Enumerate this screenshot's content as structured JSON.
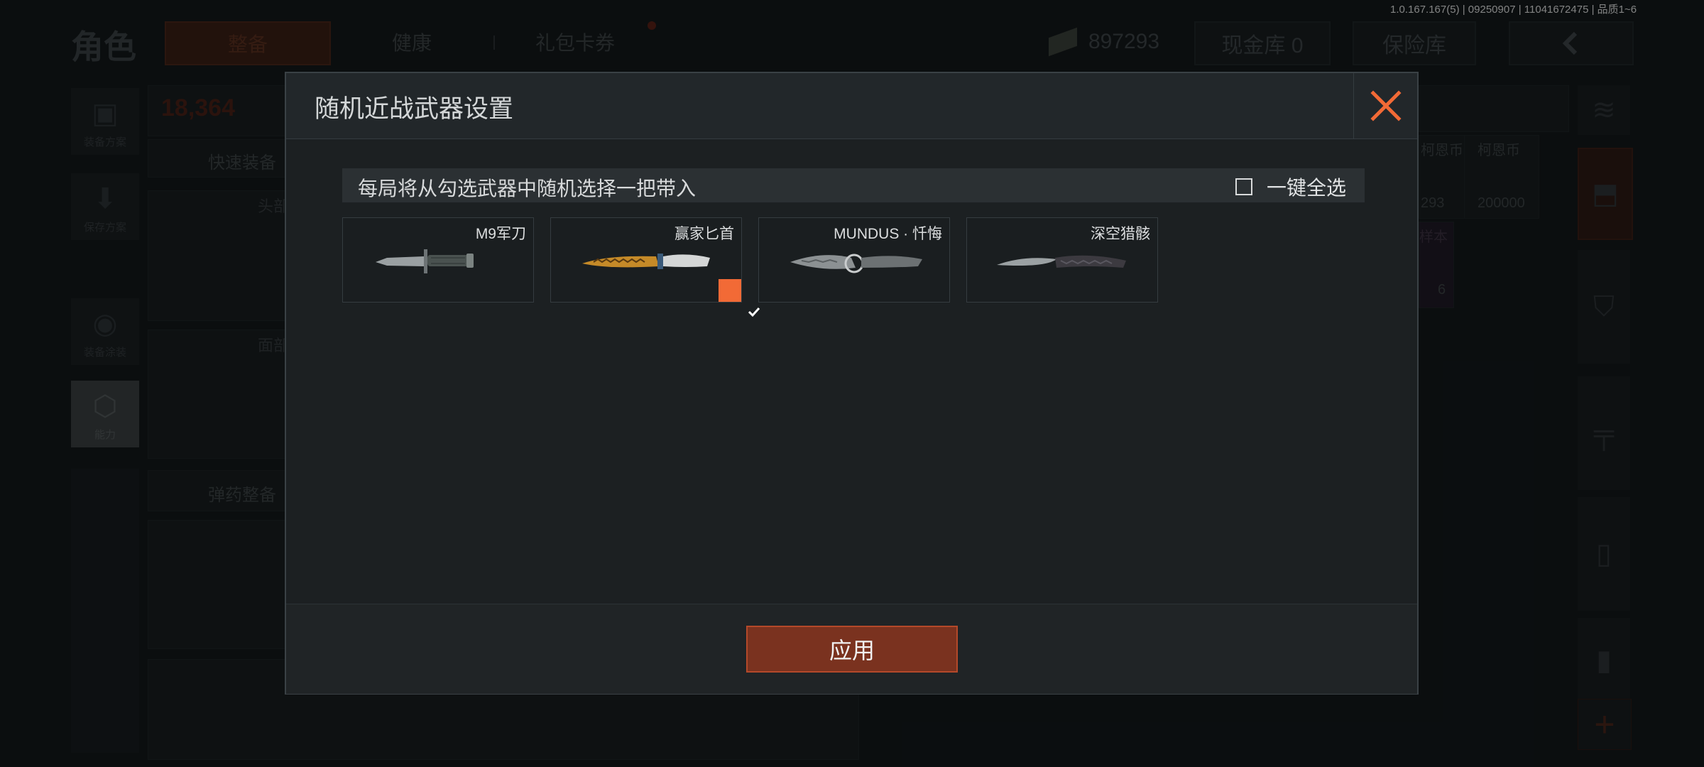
{
  "background": {
    "page_title": "角色",
    "tabs": [
      {
        "label": "整备",
        "active": true
      },
      {
        "label": "健康",
        "active": false
      },
      {
        "label": "礼包卡券",
        "active": false
      }
    ],
    "currency_value": "897293",
    "cash_vault": "现金库 0",
    "safe_box": "保险库",
    "side_buttons": [
      {
        "label": "装备方案",
        "icon": "vest-icon"
      },
      {
        "label": "保存方案",
        "icon": "download-icon"
      },
      {
        "label": "装备涂装",
        "icon": "helmet-icon"
      },
      {
        "label": "能力",
        "icon": "bolt-hex-icon"
      }
    ],
    "weight_value": "18,364",
    "quick_equip": "快速装备",
    "slot_head": "头部",
    "slot_face": "面部",
    "ammo_prep": "弹药整备",
    "right_currency_label_1": "柯恩币",
    "right_currency_label_2": "柯恩币",
    "right_currency_value_1": "293",
    "right_currency_value_2": "200000",
    "sample_label": "样本",
    "sample_count": "6"
  },
  "version": "1.0.167.167(5) | 09250907 | 11041672475 | 品质1~6",
  "modal": {
    "title": "随机近战武器设置",
    "banner_text": "每局将从勾选武器中随机选择一把带入",
    "select_all_label": "一键全选",
    "select_all_checked": false,
    "weapons": [
      {
        "name": "M9军刀",
        "checked": false,
        "icon": "bayonet-icon"
      },
      {
        "name": "赢家匕首",
        "checked": true,
        "icon": "golden-dagger-icon"
      },
      {
        "name": "MUNDUS · 忏悔",
        "checked": false,
        "icon": "engraved-blade-icon"
      },
      {
        "name": "深空猎骸",
        "checked": false,
        "icon": "curved-blade-icon"
      }
    ],
    "apply_label": "应用"
  },
  "colors": {
    "accent": "#f26a36",
    "apply_bg": "#7a321f",
    "modal_bg": "#1c2022"
  }
}
